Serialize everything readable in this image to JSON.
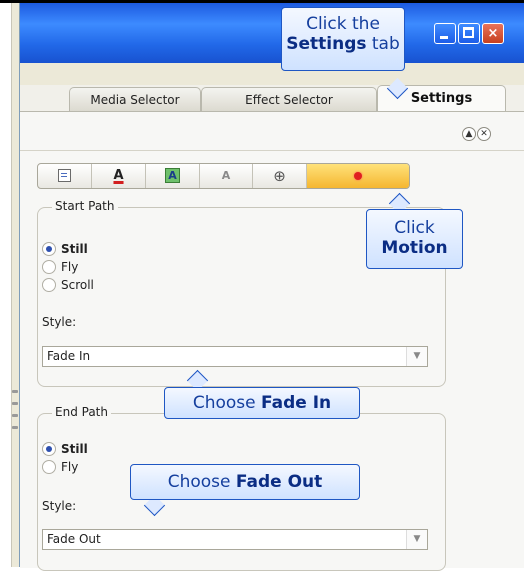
{
  "window": {
    "controls": {
      "minimize": "",
      "maximize": "",
      "close": "×"
    }
  },
  "tabs": [
    {
      "label": "Media Selector"
    },
    {
      "label": "Effect Selector"
    },
    {
      "label": "Settings"
    }
  ],
  "panel": {
    "collapse": "▲",
    "close": "✕"
  },
  "toolbar": {
    "tools": [
      {
        "icon": "list-settings-icon"
      },
      {
        "icon": "text-color-icon",
        "text": "A"
      },
      {
        "icon": "text-highlight-icon",
        "text": "A"
      },
      {
        "icon": "text-3d-icon",
        "text": "A"
      },
      {
        "icon": "position-crosshair-icon",
        "text": "⊕"
      },
      {
        "icon": "motion-record-icon",
        "selected": true
      }
    ]
  },
  "start_path": {
    "legend": "Start Path",
    "options": [
      "Still",
      "Fly",
      "Scroll"
    ],
    "selected": "Still",
    "style_label": "Style:",
    "style_value": "Fade In"
  },
  "end_path": {
    "legend": "End Path",
    "options": [
      "Still",
      "Fly"
    ],
    "selected": "Still",
    "style_label": "Style:",
    "style_value": "Fade Out"
  },
  "callouts": {
    "settings": {
      "line1": "Click the",
      "bold": "Settings",
      "suffix": " tab"
    },
    "motion": {
      "line1": "Click",
      "bold": "Motion"
    },
    "fade_in": {
      "prefix": "Choose ",
      "bold": "Fade In"
    },
    "fade_out": {
      "prefix": "Choose ",
      "bold": "Fade Out"
    }
  },
  "colors": {
    "titlebar": "#2168e8",
    "callout_border": "#1f57c3",
    "selected_tool": "#f5b630",
    "record_dot": "#e02020"
  }
}
